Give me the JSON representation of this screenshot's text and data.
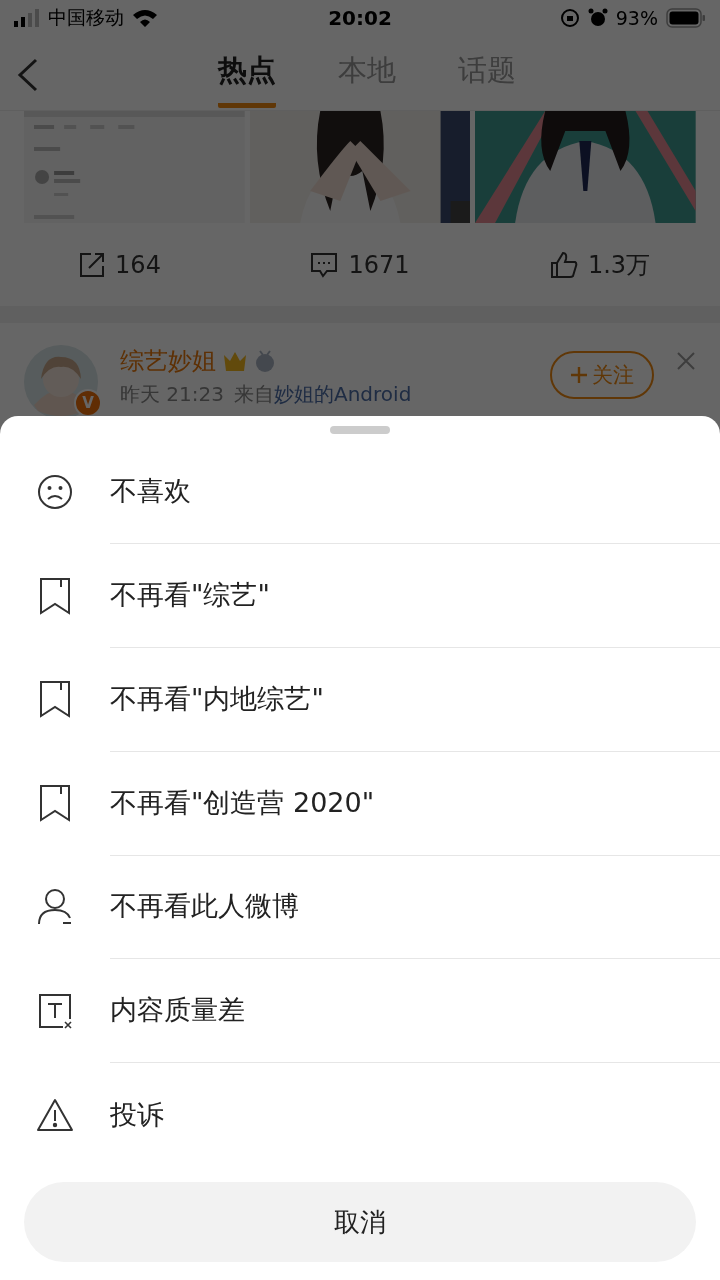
{
  "status_bar": {
    "carrier": "中国移动",
    "time": "20:02",
    "battery": "93%"
  },
  "nav": {
    "tabs": [
      {
        "label": "热点",
        "selected": true
      },
      {
        "label": "本地",
        "selected": false
      },
      {
        "label": "话题",
        "selected": false
      }
    ]
  },
  "post": {
    "stats": [
      {
        "kind": "repost",
        "value": "164"
      },
      {
        "kind": "comment",
        "value": "1671"
      },
      {
        "kind": "like",
        "value": "1.3万"
      }
    ]
  },
  "next_post": {
    "author": "综艺妙姐",
    "verified_badge": "V",
    "time": "昨天 21:23",
    "source_prefix": "来自",
    "source": "妙姐的Android",
    "follow_label": "关注"
  },
  "sheet": {
    "items": [
      {
        "kind": "dislike",
        "label": "不喜欢"
      },
      {
        "kind": "tag",
        "label": "不再看\"综艺\""
      },
      {
        "kind": "tag",
        "label": "不再看\"内地综艺\""
      },
      {
        "kind": "tag",
        "label": "不再看\"创造营 2020\""
      },
      {
        "kind": "user",
        "label": "不再看此人微博"
      },
      {
        "kind": "quality",
        "label": "内容质量差"
      },
      {
        "kind": "report",
        "label": "投诉"
      }
    ],
    "cancel": "取消"
  }
}
